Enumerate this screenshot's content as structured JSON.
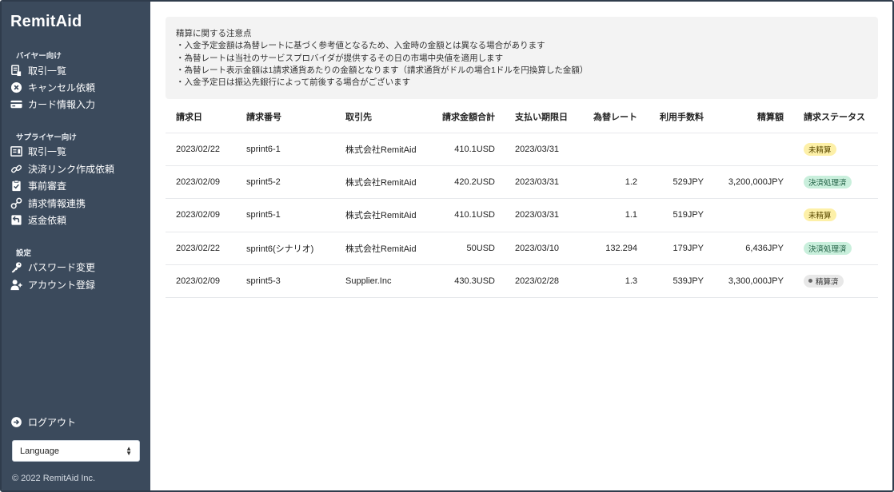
{
  "app": {
    "name": "RemitAid"
  },
  "sidebar": {
    "buyer_section": "バイヤー向け",
    "buyer_items": [
      {
        "label": "取引一覧",
        "icon": "invoice-list-icon"
      },
      {
        "label": "キャンセル依頼",
        "icon": "cancel-circle-icon"
      },
      {
        "label": "カード情報入力",
        "icon": "credit-card-icon"
      }
    ],
    "supplier_section": "サプライヤー向け",
    "supplier_items": [
      {
        "label": "取引一覧",
        "icon": "list-box-icon"
      },
      {
        "label": "決済リンク作成依頼",
        "icon": "link-icon"
      },
      {
        "label": "事前審査",
        "icon": "clipboard-check-icon"
      },
      {
        "label": "請求情報連携",
        "icon": "connect-icon"
      },
      {
        "label": "返金依頼",
        "icon": "refund-icon"
      }
    ],
    "settings_section": "設定",
    "settings_items": [
      {
        "label": "パスワード変更",
        "icon": "key-icon"
      },
      {
        "label": "アカウント登録",
        "icon": "add-user-icon"
      }
    ],
    "logout": {
      "label": "ログアウト",
      "icon": "logout-icon"
    },
    "language": {
      "value": "Language"
    },
    "copyright": "© 2022 RemitAid Inc."
  },
  "notice": {
    "lines": [
      "精算に関する注意点",
      "・入金予定金額は為替レートに基づく参考値となるため、入金時の金額とは異なる場合があります",
      "・為替レートは当社のサービスプロバイダが提供するその日の市場中央値を適用します",
      "・為替レート表示金額は1請求通貨あたりの金額となります（請求通貨がドルの場合1ドルを円換算した金額）",
      "・入金予定日は振込先銀行によって前後する場合がございます"
    ]
  },
  "table": {
    "headers": [
      "請求日",
      "請求番号",
      "取引先",
      "請求金額合計",
      "支払い期限日",
      "為替レート",
      "利用手数料",
      "精算額",
      "請求ステータス"
    ],
    "rows": [
      [
        "2023/02/22",
        "sprint6-1",
        "株式会社RemitAid",
        "410.1USD",
        "2023/03/31",
        "",
        "",
        "",
        "未精算"
      ],
      [
        "2023/02/09",
        "sprint5-2",
        "株式会社RemitAid",
        "420.2USD",
        "2023/03/31",
        "1.2",
        "529JPY",
        "3,200,000JPY",
        "決済処理済"
      ],
      [
        "2023/02/09",
        "sprint5-1",
        "株式会社RemitAid",
        "410.1USD",
        "2023/03/31",
        "1.1",
        "519JPY",
        "",
        "未精算"
      ],
      [
        "2023/02/22",
        "sprint6(シナリオ)",
        "株式会社RemitAid",
        "50USD",
        "2023/03/10",
        "132.294",
        "179JPY",
        "6,436JPY",
        "決済処理済"
      ],
      [
        "2023/02/09",
        "sprint5-3",
        "Supplier.Inc",
        "430.3USD",
        "2023/02/28",
        "1.3",
        "539JPY",
        "3,300,000JPY",
        "精算済"
      ]
    ]
  },
  "colors": {
    "sidebar_bg": "#3b4a5c",
    "badge_unsettled": "#fdf0a8",
    "badge_processed": "#c9efdc",
    "badge_settled": "#e8e8e8"
  }
}
